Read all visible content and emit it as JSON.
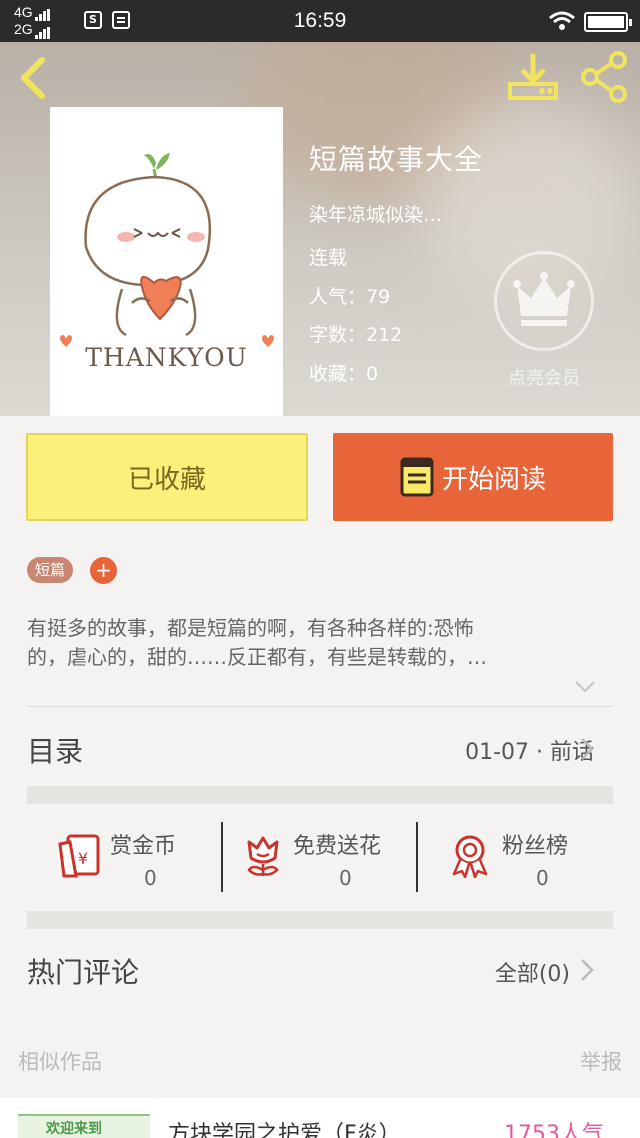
{
  "status_bar": {
    "network_top": "4G",
    "network_bottom": "2G",
    "time": "16:59"
  },
  "book": {
    "title": "短篇故事大全",
    "author": "染年凉城似染…",
    "status": "连载",
    "popularity": "人气：79",
    "word_count": "字数：212",
    "favorites": "收藏：0",
    "cover_text": "THANKYOU"
  },
  "member": {
    "label": "点亮会员"
  },
  "actions": {
    "collected_label": "已收藏",
    "read_label": "开始阅读"
  },
  "tags": {
    "items": [
      "短篇"
    ],
    "add_label": "+"
  },
  "description": {
    "line1": "有挺多的故事，都是短篇的啊，有各种各样的:恐怖",
    "line2": "的，虐心的，甜的……反正都有，有些是转载的，…"
  },
  "catalog": {
    "label": "目录",
    "latest": "01-07 · 前话"
  },
  "stats": [
    {
      "label": "赏金币",
      "value": "0",
      "icon": "coin-envelope-icon"
    },
    {
      "label": "免费送花",
      "value": "0",
      "icon": "flower-icon"
    },
    {
      "label": "粉丝榜",
      "value": "0",
      "icon": "medal-icon"
    }
  ],
  "comments": {
    "label": "热门评论",
    "all": "全部(0)"
  },
  "similar": {
    "label": "相似作品",
    "report": "举报",
    "items": [
      {
        "title": "方块学园之护爱（F炎）",
        "popularity": "1753人气",
        "thumb_text": "欢迎来到"
      }
    ]
  },
  "colors": {
    "accent": "#e8653a",
    "collected_bg": "#faf07a",
    "header_icon": "#f2e45f",
    "popularity_pink": "#e35b9f"
  }
}
